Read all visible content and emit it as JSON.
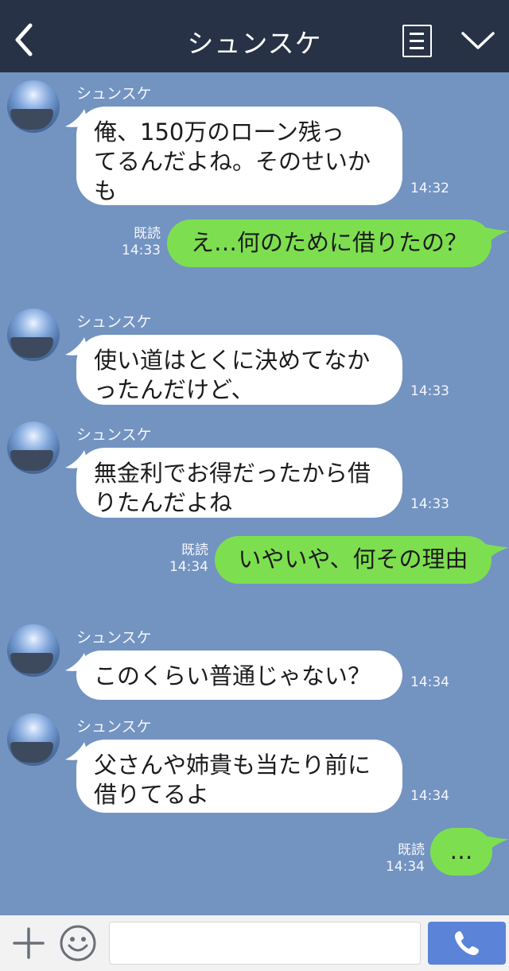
{
  "header": {
    "title": "シュンスケ"
  },
  "messages": [
    {
      "side": "in",
      "sender": "シュンスケ",
      "lines": [
        "俺、150万のローン残っ",
        "てるんだよね。そのせいか",
        "も"
      ],
      "time": "14:32"
    },
    {
      "side": "out",
      "text": "え…何のために借りたの？",
      "read": "既読",
      "time": "14:33"
    },
    {
      "side": "in",
      "sender": "シュンスケ",
      "lines": [
        "使い道はとくに決めてなか",
        "ったんだけど、"
      ],
      "time": "14:33"
    },
    {
      "side": "in",
      "sender": "シュンスケ",
      "lines": [
        "無金利でお得だったから借",
        "りたんだよね"
      ],
      "time": "14:33"
    },
    {
      "side": "out",
      "text": "いやいや、何その理由",
      "read": "既読",
      "time": "14:34"
    },
    {
      "side": "in",
      "sender": "シュンスケ",
      "lines": [
        "このくらい普通じゃない？"
      ],
      "time": "14:34"
    },
    {
      "side": "in",
      "sender": "シュンスケ",
      "lines": [
        "父さんや姉貴も当たり前に",
        "借りてるよ"
      ],
      "time": "14:34"
    },
    {
      "side": "out",
      "text": "…",
      "read": "既読",
      "time": "14:34"
    }
  ],
  "footer": {
    "input_value": ""
  },
  "colors": {
    "header": "#283246",
    "background": "#7393c1",
    "incoming": "#ffffff",
    "outgoing": "#7ddf4f",
    "send": "#5b84d8"
  },
  "icons": [
    "back-icon",
    "menu-icon",
    "chevron-down-icon",
    "plus-icon",
    "emoji-icon",
    "phone-icon"
  ]
}
